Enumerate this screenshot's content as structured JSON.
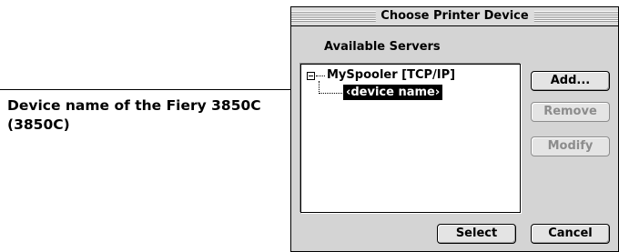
{
  "annotation": {
    "callout_line1": "Device name of the Fiery 3850C",
    "callout_line2": "(3850C)"
  },
  "dialog": {
    "title": "Choose Printer Device",
    "section_label": "Available Servers",
    "tree": {
      "server": "MySpooler [TCP/IP]",
      "device": "‹device name›",
      "expanded": true
    },
    "buttons": {
      "add": "Add...",
      "remove": "Remove",
      "modify": "Modify",
      "select": "Select",
      "cancel": "Cancel"
    },
    "button_states": {
      "add": "enabled",
      "remove": "disabled",
      "modify": "disabled",
      "select": "enabled",
      "cancel": "enabled"
    }
  }
}
